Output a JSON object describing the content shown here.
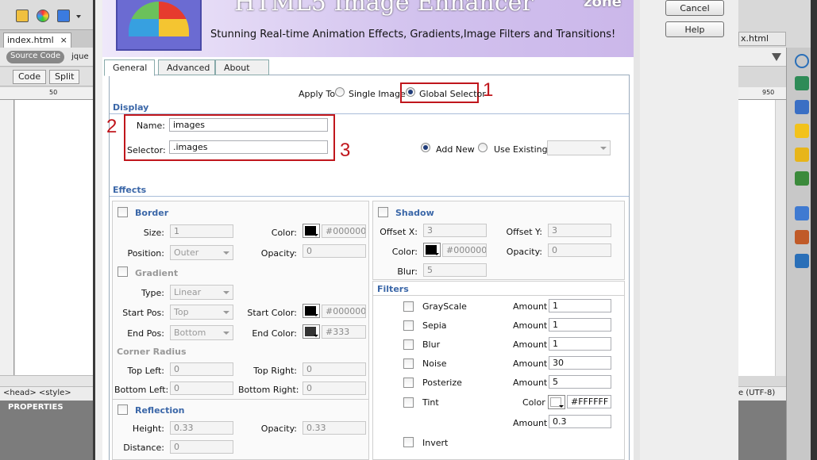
{
  "editor": {
    "tab_file": "index.html",
    "tab_close": "×",
    "source_code": "Source Code",
    "jquery_tab": "jque",
    "code_btn": "Code",
    "split_btn": "Split",
    "ruler_50": "50",
    "ruler_950": "950",
    "status_tags": "<head> <style>",
    "status_encoding": "e (UTF-8)",
    "properties": "PROPERTIES",
    "right_tab": "x.html"
  },
  "dialog": {
    "cancel": "Cancel",
    "help": "Help",
    "banner_title": "HTML5 Image Enhancer",
    "banner_brand": "zone",
    "banner_subtitle": "Stunning Real-time Animation Effects, Gradients,Image Filters and Transitions!",
    "tabs": [
      "General",
      "Advanced",
      "About"
    ],
    "apply_to": {
      "label": "Apply To",
      "single": "Single Image",
      "global": "Global Selector",
      "selected": "global"
    },
    "display": {
      "title": "Display",
      "name_label": "Name:",
      "name_value": "images",
      "selector_label": "Selector:",
      "selector_value": ".images",
      "add_new": "Add New",
      "use_existing": "Use Existing:",
      "mode": "add_new"
    },
    "annotations": [
      "1",
      "2",
      "3"
    ],
    "effects": {
      "title": "Effects",
      "border": {
        "title": "Border",
        "size_label": "Size:",
        "size": "1",
        "color_label": "Color:",
        "color": "#000000",
        "position_label": "Position:",
        "position": "Outer",
        "opacity_label": "Opacity:",
        "opacity": "0"
      },
      "gradient": {
        "title": "Gradient",
        "type_label": "Type:",
        "type": "Linear",
        "start_pos_label": "Start Pos:",
        "start_pos": "Top",
        "start_color_label": "Start Color:",
        "start_color": "#000000",
        "end_pos_label": "End Pos:",
        "end_pos": "Bottom",
        "end_color_label": "End Color:",
        "end_color": "#333"
      },
      "corner": {
        "title": "Corner Radius",
        "tl_label": "Top Left:",
        "tl": "0",
        "tr_label": "Top Right:",
        "tr": "0",
        "bl_label": "Bottom Left:",
        "bl": "0",
        "br_label": "Bottom Right:",
        "br": "0"
      },
      "reflection": {
        "title": "Reflection",
        "height_label": "Height:",
        "height": "0.33",
        "opacity_label": "Opacity:",
        "opacity": "0.33",
        "distance_label": "Distance:",
        "distance": "0"
      },
      "shadow": {
        "title": "Shadow",
        "ox_label": "Offset X:",
        "ox": "3",
        "oy_label": "Offset Y:",
        "oy": "3",
        "color_label": "Color:",
        "color": "#000000",
        "opacity_label": "Opacity:",
        "opacity": "0",
        "blur_label": "Blur:",
        "blur": "5"
      },
      "filters": {
        "title": "Filters",
        "amount_label": "Amount",
        "items": [
          {
            "name": "GrayScale",
            "amount": "1"
          },
          {
            "name": "Sepia",
            "amount": "1"
          },
          {
            "name": "Blur",
            "amount": "1"
          },
          {
            "name": "Noise",
            "amount": "30"
          },
          {
            "name": "Posterize",
            "amount": "5"
          }
        ],
        "tint": {
          "name": "Tint",
          "color_label": "Color",
          "color": "#FFFFFF",
          "amount_label": "Amount",
          "amount": "0.3"
        },
        "invert": "Invert"
      }
    }
  }
}
